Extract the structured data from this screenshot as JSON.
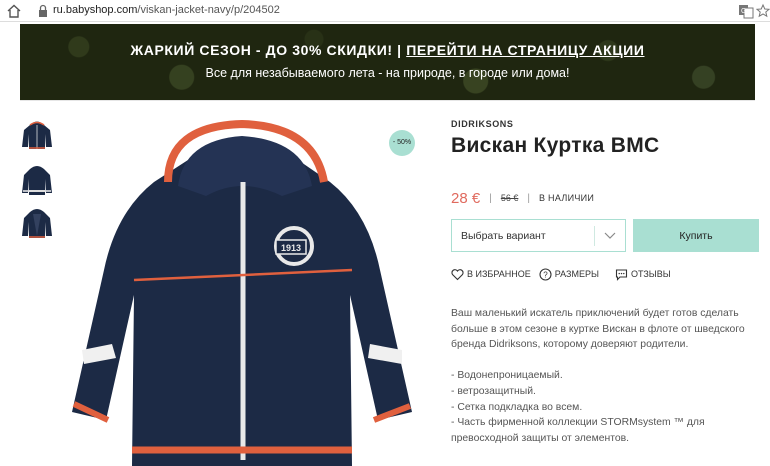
{
  "browser": {
    "url_host": "ru.babyshop.com",
    "url_path": "/viskan-jacket-navy/p/204502"
  },
  "banner": {
    "title_part1": "ЖАРКИЙ СЕЗОН - ДО 30% СКИДКИ! |",
    "title_link": "ПЕРЕЙТИ НА СТРАНИЦУ АКЦИИ",
    "subtitle": "Все для незабываемого лета - на природе, в городе или дома!"
  },
  "product": {
    "discount_badge": "- 50%",
    "brand": "DIDRIKSONS",
    "title": "Вискан Куртка ВМС",
    "price": "28 €",
    "old_price": "56 €",
    "stock": "В НАЛИЧИИ",
    "variant_placeholder": "Выбрать вариант",
    "buy_label": "Купить",
    "colors": {
      "accent": "#a9dfd2",
      "price": "#e06a5e",
      "jacket": "#1c2a45",
      "trim": "#e0603e"
    }
  },
  "actions": {
    "favorite": "В ИЗБРАННОЕ",
    "sizes": "РАЗМЕРЫ",
    "reviews": "ОТЗЫВЫ"
  },
  "description": {
    "intro": "Ваш маленький искатель приключений будет готов сделать больше в этом сезоне в куртке Вискан в флоте от шведского бренда Didriksons, которому доверяют родители.",
    "features": [
      "- Водонепроницаемый.",
      "- ветрозащитный.",
      "- Сетка подкладка во всем.",
      "- Часть фирменной коллекции STORMsystem ™ для превосходной защиты от элементов."
    ]
  },
  "jacket_logo_text": "1913"
}
